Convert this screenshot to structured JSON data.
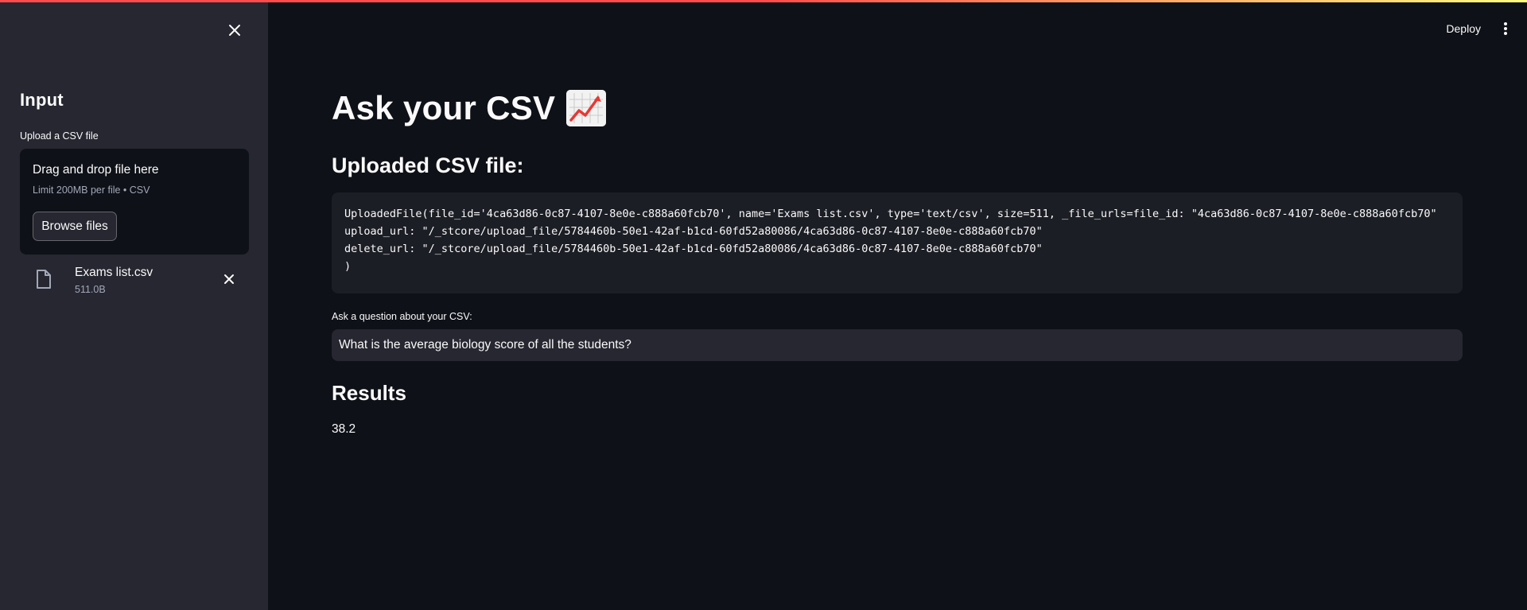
{
  "sidebar": {
    "title": "Input",
    "upload_label": "Upload a CSV file",
    "dropzone": {
      "title": "Drag and drop file here",
      "subtitle": "Limit 200MB per file • CSV",
      "browse_label": "Browse files"
    },
    "file": {
      "name": "Exams list.csv",
      "size": "511.0B"
    }
  },
  "header": {
    "deploy_label": "Deploy"
  },
  "main": {
    "title": "Ask your CSV",
    "title_icon": "chart-increasing-icon",
    "section_title": "Uploaded CSV file:",
    "code_lines": [
      "UploadedFile(file_id='4ca63d86-0c87-4107-8e0e-c888a60fcb70', name='Exams list.csv', type='text/csv', size=511, _file_urls=file_id: \"4ca63d86-0c87-4107-8e0e-c888a60fcb70\"",
      "upload_url: \"/_stcore/upload_file/5784460b-50e1-42af-b1cd-60fd52a80086/4ca63d86-0c87-4107-8e0e-c888a60fcb70\"",
      "delete_url: \"/_stcore/upload_file/5784460b-50e1-42af-b1cd-60fd52a80086/4ca63d86-0c87-4107-8e0e-c888a60fcb70\"",
      ")"
    ],
    "question_label": "Ask a question about your CSV:",
    "question_value": "What is the average biology score of all the students?",
    "results_title": "Results",
    "result_value": "38.2"
  },
  "colors": {
    "background": "#0e1117",
    "sidebar": "#262730",
    "accent_gradient_start": "#ff4b4b",
    "accent_gradient_end": "#fffd80"
  }
}
